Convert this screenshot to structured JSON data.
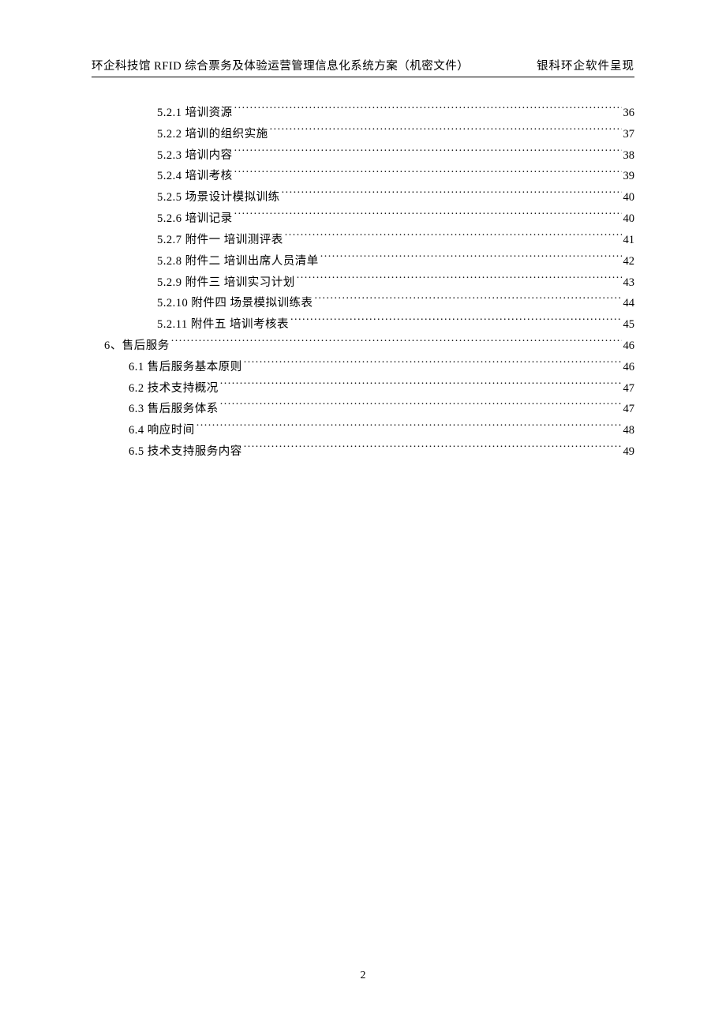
{
  "header": {
    "left": "环企科技馆 RFID 综合票务及体验运营管理信息化系统方案（机密文件）",
    "right": "银科环企软件呈现"
  },
  "toc": [
    {
      "level": 3,
      "label": "5.2.1 培训资源",
      "page": "36"
    },
    {
      "level": 3,
      "label": "5.2.2 培训的组织实施",
      "page": "37"
    },
    {
      "level": 3,
      "label": "5.2.3 培训内容",
      "page": "38"
    },
    {
      "level": 3,
      "label": "5.2.4 培训考核",
      "page": "39"
    },
    {
      "level": 3,
      "label": "5.2.5 场景设计模拟训练",
      "page": "40"
    },
    {
      "level": 3,
      "label": "5.2.6 培训记录",
      "page": "40"
    },
    {
      "level": 3,
      "label": "5.2.7 附件一 培训测评表",
      "page": "41"
    },
    {
      "level": 3,
      "label": "5.2.8 附件二 培训出席人员清单",
      "page": "42"
    },
    {
      "level": 3,
      "label": "5.2.9 附件三 培训实习计划",
      "page": "43"
    },
    {
      "level": 3,
      "label": "5.2.10 附件四 场景模拟训练表",
      "page": "44"
    },
    {
      "level": 3,
      "label": "5.2.11 附件五 培训考核表",
      "page": "45"
    },
    {
      "level": 1,
      "label": "6、售后服务",
      "page": "46"
    },
    {
      "level": 2,
      "label": "6.1 售后服务基本原则",
      "page": "46"
    },
    {
      "level": 2,
      "label": "6.2 技术支持概况",
      "page": "47"
    },
    {
      "level": 2,
      "label": "6.3 售后服务体系",
      "page": "47"
    },
    {
      "level": 2,
      "label": "6.4 响应时间",
      "page": "48"
    },
    {
      "level": 2,
      "label": "6.5 技术支持服务内容",
      "page": "49"
    }
  ],
  "pageNumber": "2"
}
